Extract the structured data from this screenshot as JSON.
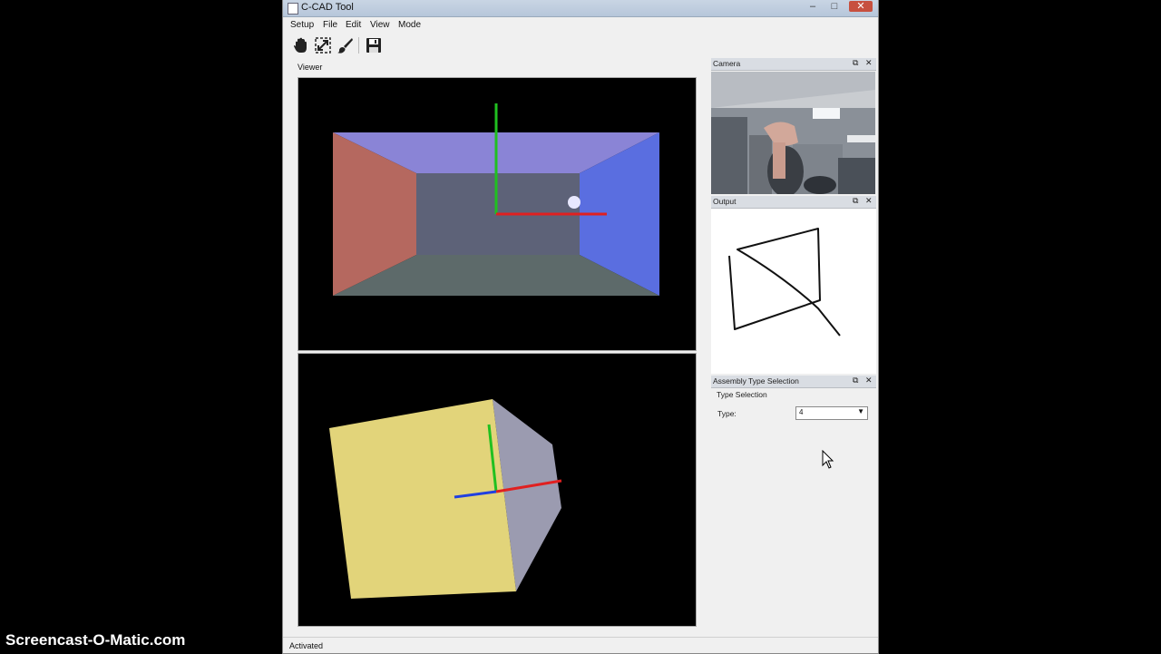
{
  "window": {
    "title": "C-CAD Tool",
    "minimize": "–",
    "maximize": "□",
    "close": "✕"
  },
  "menu": [
    "Setup",
    "File",
    "Edit",
    "View",
    "Mode"
  ],
  "toolbar": {
    "tools": [
      "hand-icon",
      "resize-icon",
      "brush-icon",
      "save-icon"
    ]
  },
  "viewer": {
    "label": "Viewer"
  },
  "docks": {
    "camera": {
      "title": "Camera"
    },
    "output": {
      "title": "Output"
    },
    "assembly": {
      "title": "Assembly Type Selection",
      "group_label": "Type Selection",
      "type_label": "Type:",
      "type_value": "4"
    },
    "float_glyph": "⧉",
    "close_glyph": "✕"
  },
  "status": {
    "text": "Activated"
  },
  "watermark": "Screencast-O-Matic.com",
  "colors": {
    "axis_x": "#e02020",
    "axis_y": "#20c020",
    "axis_z": "#2040e0",
    "box_face": "#e2d47a",
    "room_left": "#b5685f",
    "room_right": "#5a6ee0",
    "room_top": "#8a84d6"
  }
}
